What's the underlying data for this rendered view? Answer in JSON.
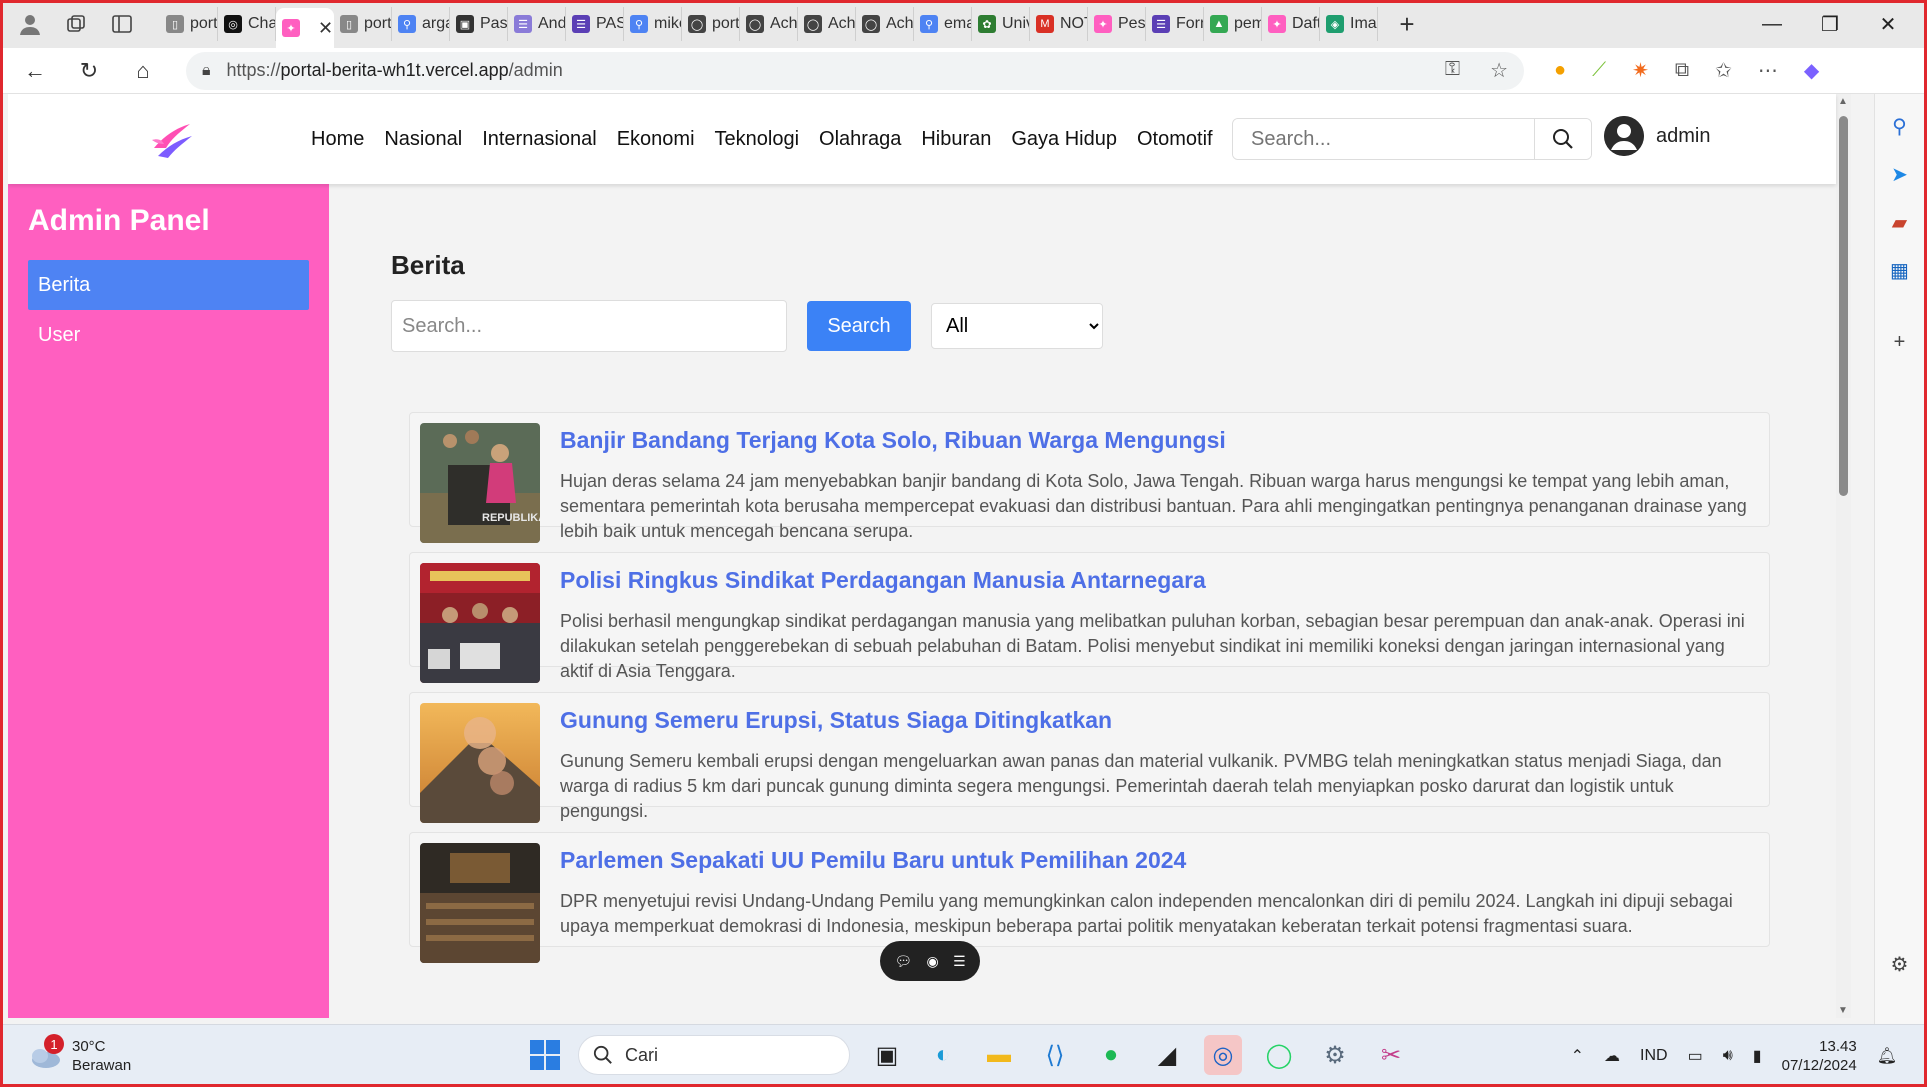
{
  "browser": {
    "tabs": [
      {
        "label": "port",
        "color": "#888888",
        "glyph": "▯"
      },
      {
        "label": "Chat",
        "color": "#111111",
        "glyph": "◎"
      },
      {
        "label": "",
        "color": "#ff5fc0",
        "glyph": "✦",
        "active": true
      },
      {
        "label": "port",
        "color": "#888888",
        "glyph": "▯"
      },
      {
        "label": "arga",
        "color": "#4e83f3",
        "glyph": "⚲"
      },
      {
        "label": "Pasc",
        "color": "#333333",
        "glyph": "▣"
      },
      {
        "label": "Andi",
        "color": "#8a7bd8",
        "glyph": "☰"
      },
      {
        "label": "PAS",
        "color": "#5b3fb5",
        "glyph": "☰"
      },
      {
        "label": "mike",
        "color": "#4e83f3",
        "glyph": "⚲"
      },
      {
        "label": "port",
        "color": "#444444",
        "glyph": "◯"
      },
      {
        "label": "Achr",
        "color": "#444444",
        "glyph": "◯"
      },
      {
        "label": "Achr",
        "color": "#444444",
        "glyph": "◯"
      },
      {
        "label": "Achr",
        "color": "#444444",
        "glyph": "◯"
      },
      {
        "label": "ema",
        "color": "#4e83f3",
        "glyph": "⚲"
      },
      {
        "label": "Univ",
        "color": "#2e7d32",
        "glyph": "✿"
      },
      {
        "label": "NOT",
        "color": "#d93025",
        "glyph": "M"
      },
      {
        "label": "Pese",
        "color": "#ff5fc0",
        "glyph": "✦"
      },
      {
        "label": "Form",
        "color": "#5b3fb5",
        "glyph": "☰"
      },
      {
        "label": "pem",
        "color": "#34a853",
        "glyph": "▲"
      },
      {
        "label": "Daft",
        "color": "#ff5fc0",
        "glyph": "✦"
      },
      {
        "label": "Imag",
        "color": "#1f9e6f",
        "glyph": "◈"
      }
    ],
    "url_scheme": "https://",
    "url_host": "portal-berita-wh1t.vercel.app",
    "url_path": "/admin"
  },
  "site": {
    "nav": [
      "Home",
      "Nasional",
      "Internasional",
      "Ekonomi",
      "Teknologi",
      "Olahraga",
      "Hiburan",
      "Gaya Hidup",
      "Otomotif"
    ],
    "search_placeholder": "Search...",
    "username": "admin",
    "accent": "#ff5fc0",
    "link_color": "#4e6fe6",
    "button_color": "#3b82f6"
  },
  "sidebar": {
    "title": "Admin Panel",
    "items": [
      {
        "label": "Berita",
        "active": true
      },
      {
        "label": "User",
        "active": false
      }
    ]
  },
  "main": {
    "heading": "Berita",
    "search_placeholder": "Search...",
    "search_button": "Search",
    "filter_selected": "All"
  },
  "articles": [
    {
      "title": "Banjir Bandang Terjang Kota Solo, Ribuan Warga Mengungsi",
      "desc": "Hujan deras selama 24 jam menyebabkan banjir bandang di Kota Solo, Jawa Tengah. Ribuan warga harus mengungsi ke tempat yang lebih aman, sementara pemerintah kota berusaha mempercepat evakuasi dan distribusi bantuan. Para ahli mengingatkan pentingnya penanganan drainase yang lebih baik untuk mencegah bencana serupa.",
      "watermark": "REPUBLIKA"
    },
    {
      "title": "Polisi Ringkus Sindikat Perdagangan Manusia Antarnegara",
      "desc": "Polisi berhasil mengungkap sindikat perdagangan manusia yang melibatkan puluhan korban, sebagian besar perempuan dan anak-anak. Operasi ini dilakukan setelah penggerebekan di sebuah pelabuhan di Batam. Polisi menyebut sindikat ini memiliki koneksi dengan jaringan internasional yang aktif di Asia Tenggara."
    },
    {
      "title": "Gunung Semeru Erupsi, Status Siaga Ditingkatkan",
      "desc": "Gunung Semeru kembali erupsi dengan mengeluarkan awan panas dan material vulkanik. PVMBG telah meningkatkan status menjadi Siaga, dan warga di radius 5 km dari puncak gunung diminta segera mengungsi. Pemerintah daerah telah menyiapkan posko darurat dan logistik untuk pengungsi."
    },
    {
      "title": "Parlemen Sepakati UU Pemilu Baru untuk Pemilihan 2024",
      "desc": "DPR menyetujui revisi Undang-Undang Pemilu yang memungkinkan calon independen mencalonkan diri di pemilu 2024. Langkah ini dipuji sebagai upaya memperkuat demokrasi di Indonesia, meskipun beberapa partai politik menyatakan keberatan terkait potensi fragmentasi suara."
    }
  ],
  "taskbar": {
    "temperature": "30°C",
    "weather": "Berawan",
    "notif_count": "1",
    "search_label": "Cari",
    "lang": "IND",
    "time": "13.43",
    "date": "07/12/2024"
  }
}
